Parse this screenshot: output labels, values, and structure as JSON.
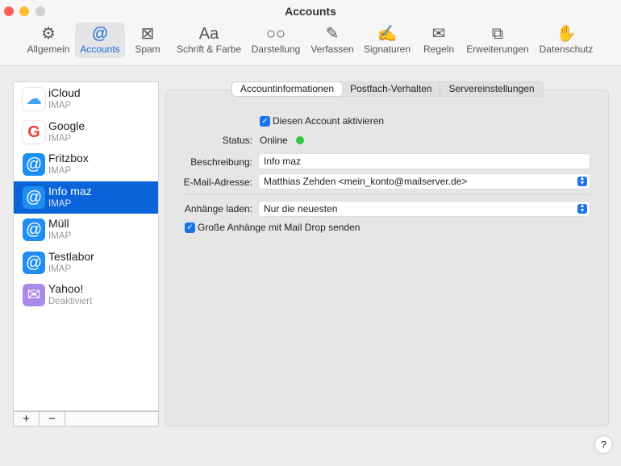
{
  "window": {
    "title": "Accounts"
  },
  "toolbar": [
    {
      "label": "Allgemein",
      "icon": "⚙"
    },
    {
      "label": "Accounts",
      "icon": "@"
    },
    {
      "label": "Spam",
      "icon": "⊠"
    },
    {
      "label": "Schrift & Farbe",
      "icon": "Aa"
    },
    {
      "label": "Darstellung",
      "icon": "○○"
    },
    {
      "label": "Verfassen",
      "icon": "✎"
    },
    {
      "label": "Signaturen",
      "icon": "✍"
    },
    {
      "label": "Regeln",
      "icon": "✉"
    },
    {
      "label": "Erweiterungen",
      "icon": "⧉"
    },
    {
      "label": "Datenschutz",
      "icon": "✋"
    }
  ],
  "accounts": [
    {
      "name": "iCloud",
      "type": "IMAP",
      "icon": "☁"
    },
    {
      "name": "Google",
      "type": "IMAP",
      "icon": "G"
    },
    {
      "name": "Fritzbox",
      "type": "IMAP",
      "icon": "@"
    },
    {
      "name": "Info maz",
      "type": "IMAP",
      "icon": "@"
    },
    {
      "name": "Müll",
      "type": "IMAP",
      "icon": "@"
    },
    {
      "name": "Testlabor",
      "type": "IMAP",
      "icon": "@"
    },
    {
      "name": "Yahoo!",
      "type": "Deaktiviert",
      "icon": "✉"
    }
  ],
  "list_buttons": {
    "add": "+",
    "remove": "−"
  },
  "tabs": [
    "Accountinformationen",
    "Postfach-Verhalten",
    "Servereinstellungen"
  ],
  "form": {
    "enable_label": "Diesen Account aktivieren",
    "status_label": "Status:",
    "status_value": "Online",
    "desc_label": "Beschreibung:",
    "desc_value": "Info maz",
    "email_label": "E-Mail-Adresse:",
    "email_value": "Matthias Zehden <mein_konto@mailserver.de>",
    "attach_label": "Anhänge laden:",
    "attach_value": "Nur die neuesten",
    "maildrop_label": "Große Anhänge mit Mail Drop senden"
  },
  "help": "?",
  "colors": {
    "accent": "#0a63d8",
    "online": "#2ec540"
  }
}
